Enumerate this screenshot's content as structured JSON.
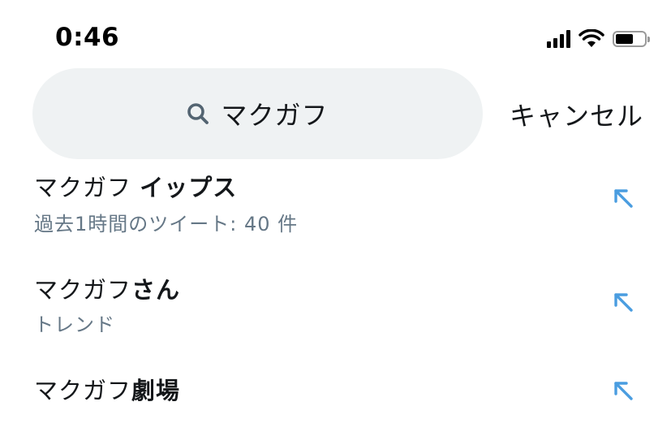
{
  "status_bar": {
    "time": "0:46"
  },
  "search": {
    "query": "マクガフ",
    "cancel_label": "キャンセル"
  },
  "suggestions": [
    {
      "prefix": "マクガフ ",
      "bold": "イップス",
      "subtitle": "過去1時間のツイート: 40 件"
    },
    {
      "prefix": "マクガフ",
      "bold": "さん",
      "subtitle": "トレンド"
    },
    {
      "prefix": "マクガフ",
      "bold": "劇場",
      "subtitle": ""
    }
  ],
  "colors": {
    "accent": "#4a9de0",
    "search_bg": "#eff2f3",
    "secondary_text": "#657786"
  },
  "icons": {
    "search": "search-icon",
    "fill_query": "arrow-up-left-icon",
    "signal": "cellular-signal-icon",
    "wifi": "wifi-icon",
    "battery": "battery-icon"
  }
}
